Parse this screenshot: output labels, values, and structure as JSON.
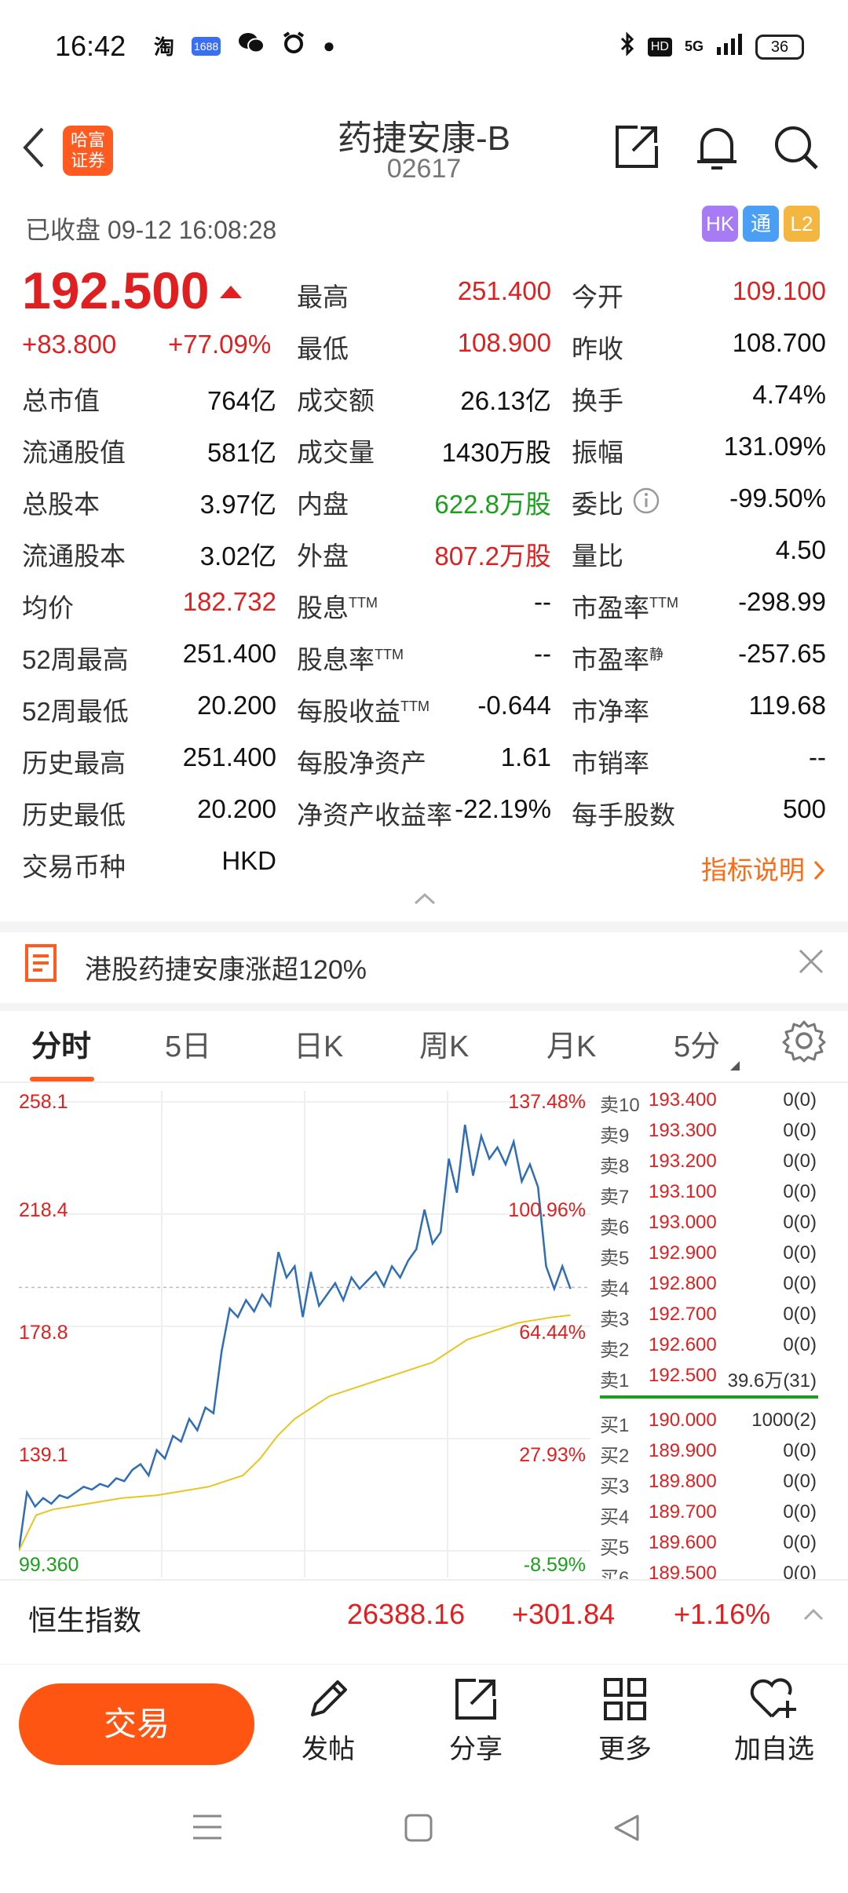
{
  "status_bar": {
    "time": "16:42",
    "app_icons": [
      "taobao-icon",
      "1688-icon",
      "wechat-icon",
      "alarm-icon",
      "dot-icon"
    ],
    "app_icon_labels": [
      "淘",
      "1688"
    ],
    "network": "5G",
    "hd_label": "HD",
    "battery": "36"
  },
  "header": {
    "broker_label": "哈富\n证券",
    "broker_line1": "哈富",
    "broker_line2": "证券",
    "title": "药捷安康-B",
    "code": "02617"
  },
  "market_status": "已收盘 09-12 16:08:28",
  "badges": [
    {
      "label": "HK",
      "color": "#a77bf3"
    },
    {
      "label": "通",
      "color": "#4a9ff5"
    },
    {
      "label": "L2",
      "color": "#f3b640"
    }
  ],
  "quote": {
    "price": "192.500",
    "change": "+83.800",
    "change_pct": "+77.09%",
    "col2": [
      {
        "label": "最高",
        "value": "251.400"
      },
      {
        "label": "最低",
        "value": "108.900"
      },
      {
        "label": "成交额",
        "value": "26.13亿"
      },
      {
        "label": "成交量",
        "value": "1430万股"
      },
      {
        "label": "内盘",
        "value": "622.8万股"
      },
      {
        "label": "外盘",
        "value": "807.2万股"
      },
      {
        "label": "股息",
        "sup": "TTM",
        "value": "--"
      },
      {
        "label": "股息率",
        "sup": "TTM",
        "value": "--"
      },
      {
        "label": "每股收益",
        "sup": "TTM",
        "value": "-0.644"
      },
      {
        "label": "每股净资产",
        "value": "1.61"
      },
      {
        "label": "净资产收益率",
        "value": "-22.19%"
      }
    ],
    "col3": [
      {
        "label": "今开",
        "value": "109.100"
      },
      {
        "label": "昨收",
        "value": "108.700"
      },
      {
        "label": "换手",
        "value": "4.74%"
      },
      {
        "label": "振幅",
        "value": "131.09%"
      },
      {
        "label": "委比",
        "value": "-99.50%"
      },
      {
        "label": "量比",
        "value": "4.50"
      },
      {
        "label": "市盈率",
        "sup": "TTM",
        "value": "-298.99"
      },
      {
        "label": "市盈率",
        "sup": "静",
        "value": "-257.65"
      },
      {
        "label": "市净率",
        "value": "119.68"
      },
      {
        "label": "市销率",
        "value": "--"
      },
      {
        "label": "每手股数",
        "value": "500"
      }
    ],
    "col1": [
      {
        "label": "总市值",
        "value": "764亿"
      },
      {
        "label": "流通股值",
        "value": "581亿"
      },
      {
        "label": "总股本",
        "value": "3.97亿"
      },
      {
        "label": "流通股本",
        "value": "3.02亿"
      },
      {
        "label": "均价",
        "value": "182.732"
      },
      {
        "label": "52周最高",
        "value": "251.400"
      },
      {
        "label": "52周最低",
        "value": "20.200"
      },
      {
        "label": "历史最高",
        "value": "251.400"
      },
      {
        "label": "历史最低",
        "value": "20.200"
      },
      {
        "label": "交易币种",
        "value": "HKD"
      }
    ],
    "indicator_link": "指标说明"
  },
  "news": {
    "text": "港股药捷安康涨超120%"
  },
  "tabs": [
    "分时",
    "5日",
    "日K",
    "周K",
    "月K",
    "5分"
  ],
  "chart_data": {
    "type": "line",
    "y_left_ticks": [
      "258.1",
      "218.4",
      "178.8",
      "139.1",
      "99.360"
    ],
    "y_right_ticks": [
      "137.48%",
      "100.96%",
      "64.44%",
      "27.93%",
      "-8.59%"
    ],
    "ylim": [
      99.36,
      258.1
    ],
    "prev_close": 108.7,
    "series": [
      {
        "values": [
          99.4,
          120,
          115,
          118,
          116,
          119,
          118,
          120,
          122,
          121,
          123,
          122,
          125,
          124,
          128,
          130,
          126,
          135,
          132,
          140,
          138,
          146,
          142,
          150,
          148,
          170,
          185,
          182,
          188,
          184,
          190,
          186,
          205,
          196,
          200,
          182,
          198,
          186,
          190,
          194,
          188,
          196,
          192,
          195,
          198,
          193,
          200,
          196,
          202,
          206,
          220,
          208,
          212,
          238,
          226,
          250,
          232,
          246,
          238,
          242,
          236,
          244,
          230,
          236,
          228,
          200,
          192,
          200,
          192
        ]
      },
      {
        "values": [
          99.4,
          112,
          114,
          115,
          116,
          117,
          118,
          118.5,
          119,
          120,
          121,
          122,
          124,
          126,
          132,
          140,
          146,
          150,
          154,
          156,
          158,
          160,
          162,
          164,
          166,
          170,
          174,
          176,
          178,
          180,
          181,
          182,
          182.7
        ]
      }
    ]
  },
  "order_book": {
    "asks": [
      {
        "label": "卖10",
        "price": "193.400",
        "qty": "0(0)"
      },
      {
        "label": "卖9",
        "price": "193.300",
        "qty": "0(0)"
      },
      {
        "label": "卖8",
        "price": "193.200",
        "qty": "0(0)"
      },
      {
        "label": "卖7",
        "price": "193.100",
        "qty": "0(0)"
      },
      {
        "label": "卖6",
        "price": "193.000",
        "qty": "0(0)"
      },
      {
        "label": "卖5",
        "price": "192.900",
        "qty": "0(0)"
      },
      {
        "label": "卖4",
        "price": "192.800",
        "qty": "0(0)"
      },
      {
        "label": "卖3",
        "price": "192.700",
        "qty": "0(0)"
      },
      {
        "label": "卖2",
        "price": "192.600",
        "qty": "0(0)"
      },
      {
        "label": "卖1",
        "price": "192.500",
        "qty": "39.6万(31)"
      }
    ],
    "bids": [
      {
        "label": "买1",
        "price": "190.000",
        "qty": "1000(2)"
      },
      {
        "label": "买2",
        "price": "189.900",
        "qty": "0(0)"
      },
      {
        "label": "买3",
        "price": "189.800",
        "qty": "0(0)"
      },
      {
        "label": "买4",
        "price": "189.700",
        "qty": "0(0)"
      },
      {
        "label": "买5",
        "price": "189.600",
        "qty": "0(0)"
      },
      {
        "label": "买6",
        "price": "189.500",
        "qty": "0(0)"
      }
    ]
  },
  "index_bar": {
    "name": "恒生指数",
    "value": "26388.16",
    "change": "+301.84",
    "change_pct": "+1.16%"
  },
  "bottom_nav": {
    "trade": "交易",
    "items": [
      {
        "label": "发帖",
        "icon": "pencil-icon"
      },
      {
        "label": "分享",
        "icon": "share-icon"
      },
      {
        "label": "更多",
        "icon": "grid-icon"
      },
      {
        "label": "加自选",
        "icon": "heart-plus-icon"
      }
    ]
  },
  "colors": {
    "up": "#e02020",
    "down": "#1aa01a",
    "accent": "#ff5a1f"
  }
}
